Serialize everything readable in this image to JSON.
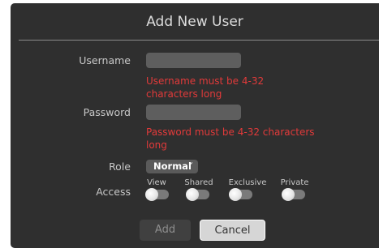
{
  "dialog": {
    "title": "Add New User"
  },
  "form": {
    "username_label": "Username",
    "username_value": "",
    "username_error": "Username must be 4-32 characters long",
    "password_label": "Password",
    "password_value": "",
    "password_error": "Password must be 4-32 characters long",
    "role_label": "Role",
    "role_selected": "Normal",
    "access_label": "Access",
    "access_options": [
      {
        "label": "View",
        "enabled": false
      },
      {
        "label": "Shared",
        "enabled": false
      },
      {
        "label": "Exclusive",
        "enabled": false
      },
      {
        "label": "Private",
        "enabled": false
      }
    ]
  },
  "buttons": {
    "add_label": "Add",
    "cancel_label": "Cancel"
  },
  "colors": {
    "dialog_bg": "#2f2f2f",
    "error": "#e23a3a",
    "input_bg": "#5e5e5e"
  }
}
